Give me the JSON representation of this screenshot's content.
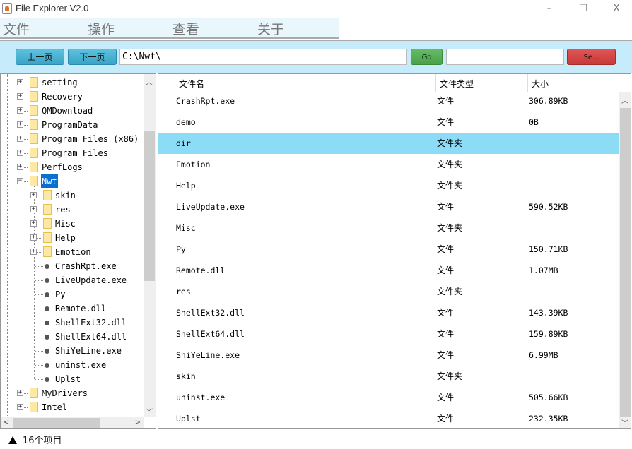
{
  "window": {
    "title": "File Explorer V2.0",
    "minimize": "–",
    "maximize": "☐",
    "close": "X"
  },
  "menu": [
    "文件",
    "操作",
    "查看",
    "关于"
  ],
  "toolbar": {
    "prev": "上一页",
    "next": "下一页",
    "path": "C:\\Nwt\\",
    "go": "Go",
    "search_value": "",
    "search": "Se..."
  },
  "tree": [
    {
      "label": "setting",
      "level": 0,
      "type": "folder",
      "expander": "+"
    },
    {
      "label": "Recovery",
      "level": 0,
      "type": "folder",
      "expander": "+"
    },
    {
      "label": "QMDownload",
      "level": 0,
      "type": "folder",
      "expander": "+"
    },
    {
      "label": "ProgramData",
      "level": 0,
      "type": "folder",
      "expander": "+"
    },
    {
      "label": "Program Files (x86)",
      "level": 0,
      "type": "folder",
      "expander": "+"
    },
    {
      "label": "Program Files",
      "level": 0,
      "type": "folder",
      "expander": "+"
    },
    {
      "label": "PerfLogs",
      "level": 0,
      "type": "folder",
      "expander": "+"
    },
    {
      "label": "Nwt",
      "level": 0,
      "type": "folder",
      "expander": "−",
      "selected": true
    },
    {
      "label": "skin",
      "level": 1,
      "type": "folder",
      "expander": "+"
    },
    {
      "label": "res",
      "level": 1,
      "type": "folder",
      "expander": "+"
    },
    {
      "label": "Misc",
      "level": 1,
      "type": "folder",
      "expander": "+"
    },
    {
      "label": "Help",
      "level": 1,
      "type": "folder",
      "expander": "+"
    },
    {
      "label": "Emotion",
      "level": 1,
      "type": "folder",
      "expander": "+"
    },
    {
      "label": "CrashRpt.exe",
      "level": 1,
      "type": "file"
    },
    {
      "label": "LiveUpdate.exe",
      "level": 1,
      "type": "file"
    },
    {
      "label": "Py",
      "level": 1,
      "type": "file"
    },
    {
      "label": "Remote.dll",
      "level": 1,
      "type": "file"
    },
    {
      "label": "ShellExt32.dll",
      "level": 1,
      "type": "file"
    },
    {
      "label": "ShellExt64.dll",
      "level": 1,
      "type": "file"
    },
    {
      "label": "ShiYeLine.exe",
      "level": 1,
      "type": "file"
    },
    {
      "label": "uninst.exe",
      "level": 1,
      "type": "file"
    },
    {
      "label": "Uplst",
      "level": 1,
      "type": "file"
    },
    {
      "label": "MyDrivers",
      "level": 0,
      "type": "folder",
      "expander": "+"
    },
    {
      "label": "Intel",
      "level": 0,
      "type": "folder",
      "expander": "+"
    }
  ],
  "table": {
    "columns": [
      "文件名",
      "文件类型",
      "大小"
    ],
    "rows": [
      {
        "name": "CrashRpt.exe",
        "type": "文件",
        "size": "306.89KB"
      },
      {
        "name": "demo",
        "type": "文件",
        "size": "0B"
      },
      {
        "name": "dir",
        "type": "文件夹",
        "size": "",
        "selected": true
      },
      {
        "name": "Emotion",
        "type": "文件夹",
        "size": ""
      },
      {
        "name": "Help",
        "type": "文件夹",
        "size": ""
      },
      {
        "name": "LiveUpdate.exe",
        "type": "文件",
        "size": "590.52KB"
      },
      {
        "name": "Misc",
        "type": "文件夹",
        "size": ""
      },
      {
        "name": "Py",
        "type": "文件",
        "size": "150.71KB"
      },
      {
        "name": "Remote.dll",
        "type": "文件",
        "size": "1.07MB"
      },
      {
        "name": "res",
        "type": "文件夹",
        "size": ""
      },
      {
        "name": "ShellExt32.dll",
        "type": "文件",
        "size": "143.39KB"
      },
      {
        "name": "ShellExt64.dll",
        "type": "文件",
        "size": "159.89KB"
      },
      {
        "name": "ShiYeLine.exe",
        "type": "文件",
        "size": "6.99MB"
      },
      {
        "name": "skin",
        "type": "文件夹",
        "size": ""
      },
      {
        "name": "uninst.exe",
        "type": "文件",
        "size": "505.66KB"
      },
      {
        "name": "Uplst",
        "type": "文件",
        "size": "232.35KB"
      }
    ]
  },
  "status": "16个项目",
  "colors": {
    "toolbar_bg": "#c6ecfb",
    "selected_row": "#8cdcf8",
    "tree_selection": "#0a6fd0",
    "go": "#49a249",
    "search": "#c83a3a"
  }
}
